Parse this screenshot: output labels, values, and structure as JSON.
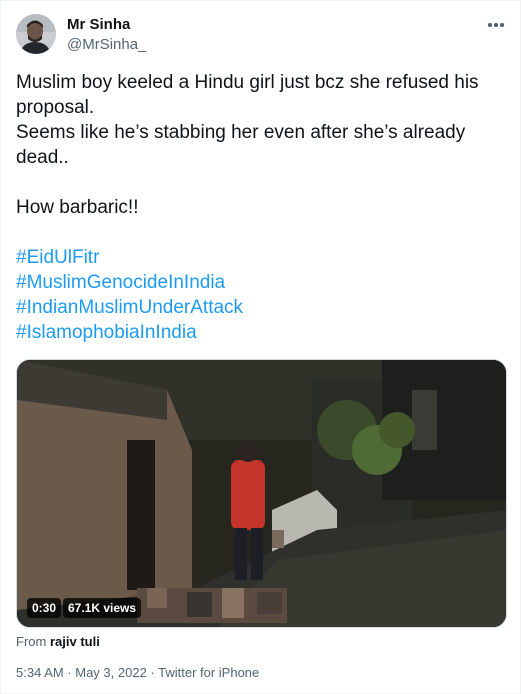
{
  "tweet": {
    "display_name": "Mr Sinha",
    "handle": "@MrSinha_",
    "lines": [
      {
        "text": "Muslim boy keeled a Hindu girl just bcz she refused his",
        "hashtag": false
      },
      {
        "text": "proposal.",
        "hashtag": false
      },
      {
        "text": "Seems like he’s stabbing her even after she’s already",
        "hashtag": false
      },
      {
        "text": "dead..",
        "hashtag": false
      },
      {
        "text": "",
        "hashtag": false
      },
      {
        "text": "How barbaric!!",
        "hashtag": false
      },
      {
        "text": "",
        "hashtag": false
      },
      {
        "text": "#EidUlFitr",
        "hashtag": true
      },
      {
        "text": "#MuslimGenocideInIndia",
        "hashtag": true
      },
      {
        "text": "#IndianMuslimUnderAttack",
        "hashtag": true
      },
      {
        "text": "#IslamophobiaInIndia",
        "hashtag": true
      }
    ],
    "hashtag_color": "#1d9bf0"
  },
  "video": {
    "duration": "0:30",
    "views": "67.1K views",
    "from_label": "From",
    "from_name": "rajiv tuli"
  },
  "footer": {
    "timestamp": "5:34 AM · May 3, 2022 · Twitter for iPhone"
  },
  "icons": {
    "more": "more-horizontal-icon"
  }
}
